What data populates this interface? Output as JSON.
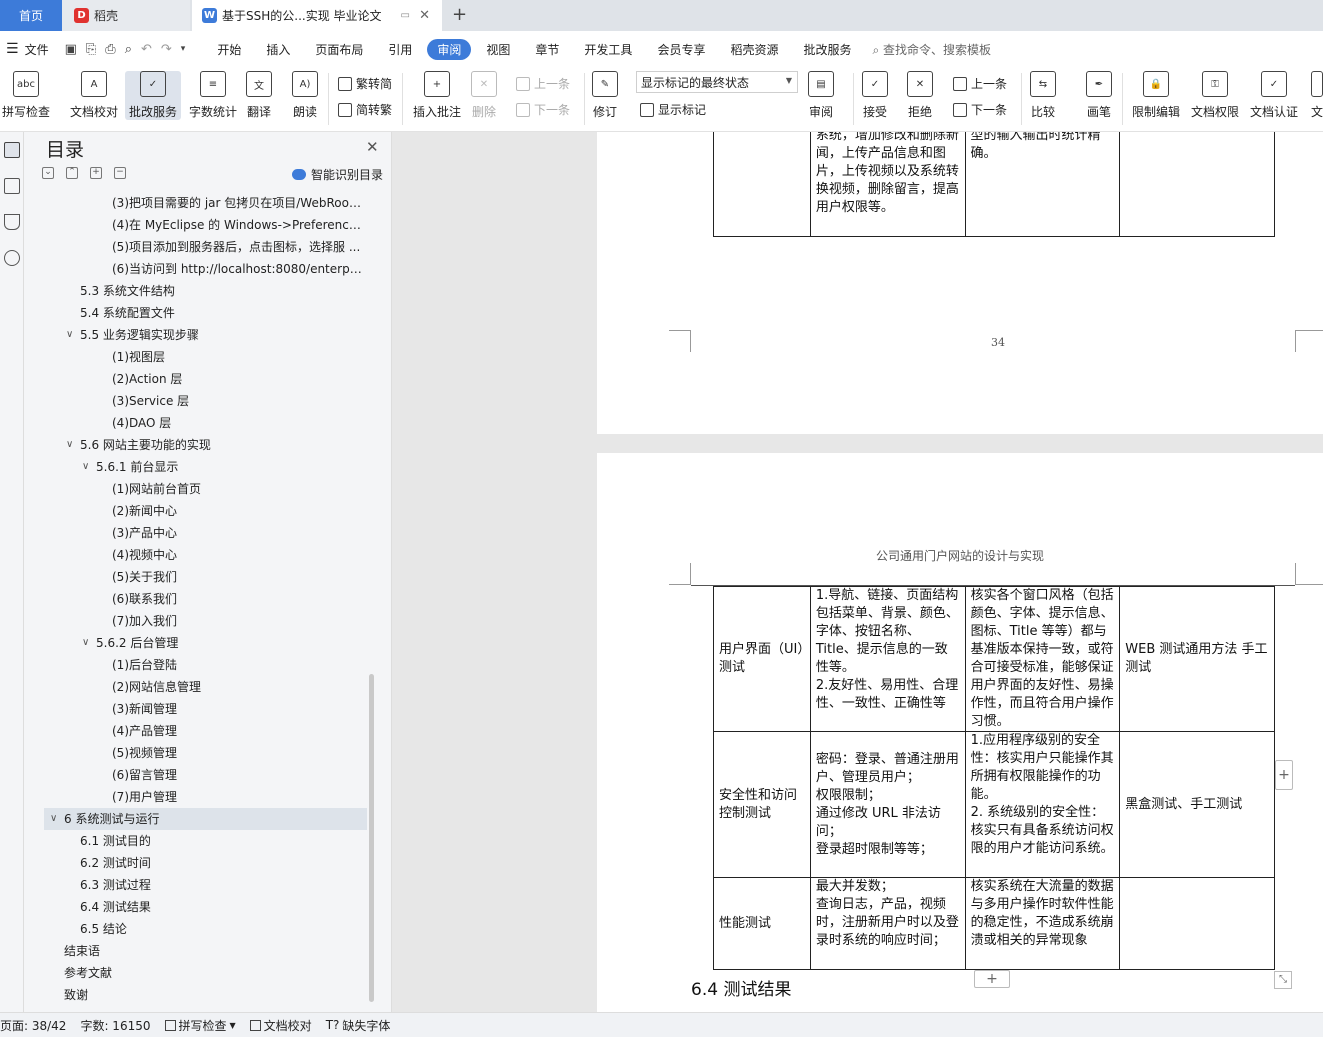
{
  "tabs": {
    "home": "首页",
    "daoke": "稻壳",
    "doc": "基于SSH的公...实现 毕业论文"
  },
  "menu": {
    "file": "文件",
    "items": [
      "开始",
      "插入",
      "页面布局",
      "引用",
      "审阅",
      "视图",
      "章节",
      "开发工具",
      "会员专享",
      "稻壳资源",
      "批改服务"
    ],
    "active": "审阅",
    "search": "查找命令、搜索模板"
  },
  "ribbon": {
    "spell_check": "拼写检查",
    "doc_proof": "文档校对",
    "correction_service": "批改服务",
    "word_count": "字数统计",
    "translate": "翻译",
    "read_aloud": "朗读",
    "trad_to_simp": "繁转简",
    "simp_to_trad": "简转繁",
    "insert_comment": "插入批注",
    "delete": "删除",
    "prev_comment": "上一条",
    "next_comment": "下一条",
    "revise": "修订",
    "display_state": "显示标记的最终状态",
    "show_markup": "显示标记",
    "review": "审阅",
    "accept": "接受",
    "reject": "拒绝",
    "prev_change": "上一条",
    "next_change": "下一条",
    "compare": "比较",
    "pen": "画笔",
    "restrict_edit": "限制编辑",
    "doc_permission": "文档权限",
    "doc_certify": "文档认证",
    "more": "文"
  },
  "toc": {
    "title": "目录",
    "smart": "智能识别目录",
    "items": [
      {
        "text": "(3)把项目需要的 jar 包拷贝在项目/WebRoo ..."
      },
      {
        "text": "(4)在 MyEclipse 的 Windows->Preference ..."
      },
      {
        "text": "(5)项目添加到服务器后，点击图标，选择服 ..."
      },
      {
        "text": "(6)当访问到 http://localhost:8080/enterpr ..."
      },
      {
        "text": "5.3  系统文件结构"
      },
      {
        "text": "5.4  系统配置文件"
      },
      {
        "text": "5.5  业务逻辑实现步骤"
      },
      {
        "text": "(1)视图层"
      },
      {
        "text": "(2)Action 层"
      },
      {
        "text": "(3)Service 层"
      },
      {
        "text": "(4)DAO 层"
      },
      {
        "text": "5.6  网站主要功能的实现"
      },
      {
        "text": "5.6.1  前台显示"
      },
      {
        "text": "(1)网站前台首页"
      },
      {
        "text": "(2)新闻中心"
      },
      {
        "text": "(3)产品中心"
      },
      {
        "text": "(4)视频中心"
      },
      {
        "text": "(5)关于我们"
      },
      {
        "text": "(6)联系我们"
      },
      {
        "text": "(7)加入我们"
      },
      {
        "text": "5.6.2  后台管理"
      },
      {
        "text": "(1)后台登陆"
      },
      {
        "text": "(2)网站信息管理"
      },
      {
        "text": "(3)新闻管理"
      },
      {
        "text": "(4)产品管理"
      },
      {
        "text": "(5)视频管理"
      },
      {
        "text": "(6)留言管理"
      },
      {
        "text": "(7)用户管理"
      },
      {
        "text": "6  系统测试与运行"
      },
      {
        "text": "6.1  测试目的"
      },
      {
        "text": "6.2  测试时间"
      },
      {
        "text": "6.3  测试过程"
      },
      {
        "text": "6.4  测试结果"
      },
      {
        "text": "6.5  结论"
      },
      {
        "text": "结束语"
      },
      {
        "text": "参考文献"
      },
      {
        "text": "致谢"
      }
    ]
  },
  "page1": {
    "cell_b": "系统，增加修改和删除新闻，上传产品信息和图片，上传视频以及系统转换视频，删除留言，提高用户权限等。",
    "cell_c": "型的输入输出时统计精确。",
    "page_number": "34"
  },
  "page2": {
    "header": "公司通用门户网站的设计与实现",
    "rows": [
      {
        "name": "用户界面（UI）测试",
        "content": "1.导航、链接、页面结构包括菜单、背景、颜色、字体、按钮名称、Title、提示信息的一致性等。\n2.友好性、易用性、合理性、一致性、正确性等",
        "goal": "核实各个窗口风格（包括颜色、字体、提示信息、图标、Title 等等）都与基准版本保持一致，或符合可接受标准，能够保证用户界面的友好性、易操作性，而且符合用户操作习惯。",
        "method": "WEB 测试通用方法 手工测试"
      },
      {
        "name": "安全性和访问控制测试",
        "content": "密码：登录、普通注册用户、管理员用户；\n权限限制；\n通过修改 URL 非法访问；\n登录超时限制等等；",
        "goal": "1.应用程序级别的安全性：核实用户只能操作其所拥有权限能操作的功能。\n2. 系统级别的安全性：核实只有具备系统访问权限的用户才能访问系统。",
        "method": "黑盒测试、手工测试"
      },
      {
        "name": "性能测试",
        "content": "最大并发数；\n查询日志，产品，视频时，注册新用户时以及登录时系统的响应时间；",
        "goal": "核实系统在大流量的数据与多用户操作时软件性能的稳定性，不造成系统崩溃或相关的异常现象",
        "method": ""
      }
    ],
    "heading": "6.4   测试结果"
  },
  "status": {
    "page": "页面: 38/42",
    "words": "字数: 16150",
    "spell": "拼写检查",
    "proof": "文档校对",
    "missing_font": "缺失字体"
  },
  "colors": {
    "accent": "#3d7bd9",
    "tab_bar": "#dfe3e8",
    "panel": "#f4f5f7"
  }
}
